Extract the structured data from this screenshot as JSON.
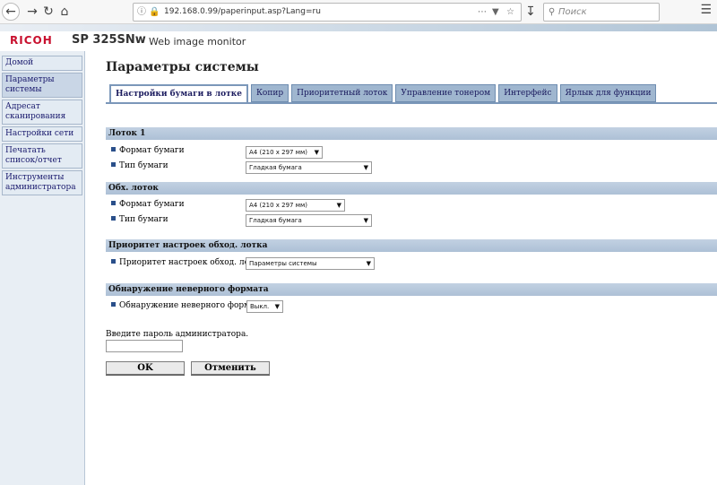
{
  "browser": {
    "url": "192.168.0.99/paperinput.asp?Lang=ru",
    "search_placeholder": "Поиск"
  },
  "header": {
    "brand": "RICOH",
    "model": "SP 325SNw",
    "subtitle": "Web image monitor"
  },
  "sidebar": {
    "items": [
      {
        "label": "Домой"
      },
      {
        "label": "Параметры системы"
      },
      {
        "label": "Адресат сканирования"
      },
      {
        "label": "Настройки сети"
      },
      {
        "label": "Печатать список/отчет"
      },
      {
        "label": "Инструменты администратора"
      }
    ]
  },
  "page": {
    "title": "Параметры системы",
    "tabs": [
      {
        "label": "Настройки бумаги в лотке"
      },
      {
        "label": "Копир"
      },
      {
        "label": "Приоритетный лоток"
      },
      {
        "label": "Управление тонером"
      },
      {
        "label": "Интерфейс"
      },
      {
        "label": "Ярлык для функции"
      }
    ]
  },
  "sections": {
    "tray1": {
      "heading": "Лоток 1",
      "size_label": "Формат бумаги",
      "size_value": "A4 (210 x 297 мм)",
      "type_label": "Тип бумаги",
      "type_value": "Гладкая бумага"
    },
    "bypass": {
      "heading": "Обх. лоток",
      "size_label": "Формат бумаги",
      "size_value": "A4 (210 x 297 мм)",
      "type_label": "Тип бумаги",
      "type_value": "Гладкая бумага"
    },
    "bypass_priority": {
      "heading": "Приоритет настроек обход. лотка",
      "label": "Приоритет настроек обход. лотка",
      "value": "Параметры системы"
    },
    "mismatch": {
      "heading": "Обнаружение неверного формата",
      "label": "Обнаружение неверного формата",
      "value": "Выкл."
    }
  },
  "password": {
    "label": "Введите пароль администратора.",
    "value": ""
  },
  "buttons": {
    "ok": "OK",
    "cancel": "Отменить"
  }
}
